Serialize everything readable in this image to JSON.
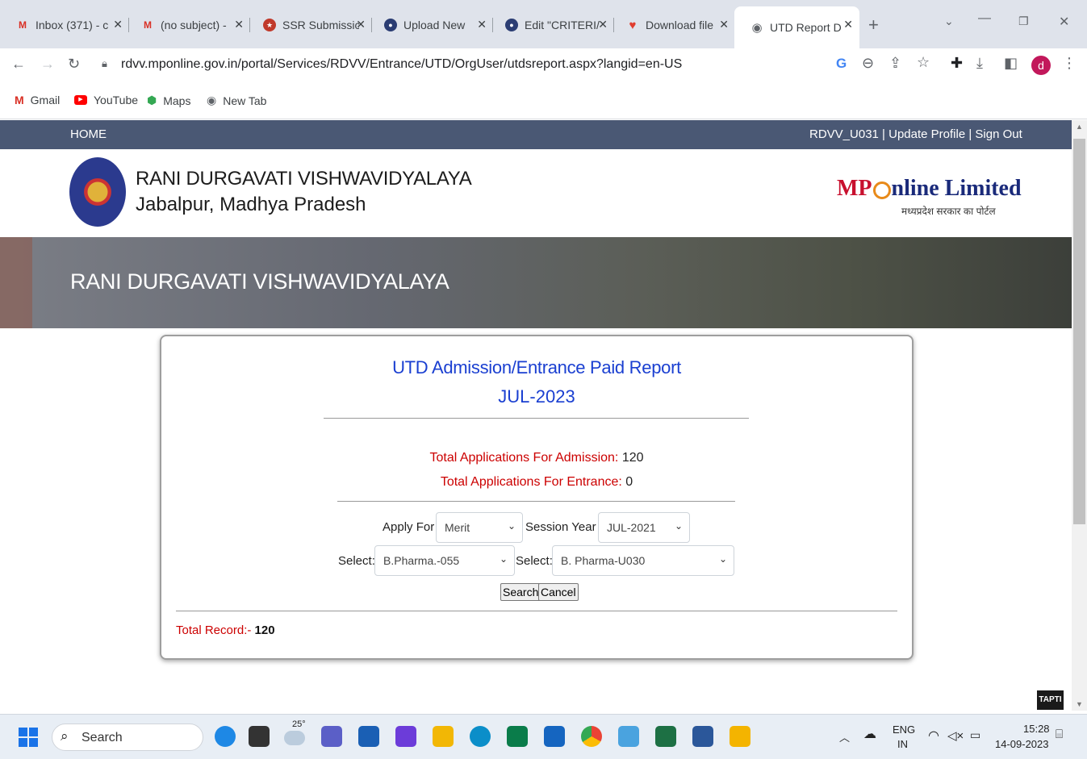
{
  "browser": {
    "tabs": [
      {
        "title": "Inbox (371) - c",
        "icon": "gmail-icon"
      },
      {
        "title": "(no subject) -",
        "icon": "gmail-icon"
      },
      {
        "title": "SSR Submissic",
        "icon": "ssr-icon"
      },
      {
        "title": "Upload New",
        "icon": "upload-icon"
      },
      {
        "title": "Edit \"CRITERI/",
        "icon": "edit-icon"
      },
      {
        "title": "Download file",
        "icon": "heart-icon"
      },
      {
        "title": "UTD Report D",
        "icon": "globe-icon"
      }
    ],
    "url": "rdvv.mponline.gov.in/portal/Services/RDVV/Entrance/UTD/OrgUser/utdsreport.aspx?langid=en-US",
    "profile_initial": "d",
    "bookmarks": [
      {
        "label": "Gmail",
        "icon": "gmail-icon"
      },
      {
        "label": "YouTube",
        "icon": "youtube-icon"
      },
      {
        "label": "Maps",
        "icon": "maps-icon"
      },
      {
        "label": "New Tab",
        "icon": "globe-icon"
      }
    ]
  },
  "nav": {
    "home": "HOME",
    "user": "RDVV_U031",
    "sep1": " | ",
    "update_profile": "Update Profile",
    "sep2": " | ",
    "sign_out": "Sign Out"
  },
  "header": {
    "university_name": "RANI DURGAVATI VISHWAVIDYALAYA",
    "location": "Jabalpur, Madhya Pradesh",
    "brand": "MP",
    "brand_rest": "nline Limited",
    "brand_tagline": "मध्यप्रदेश सरकार का पोर्टल",
    "banner_title": "RANI DURGAVATI VISHWAVIDYALAYA"
  },
  "report": {
    "title": "UTD Admission/Entrance Paid Report",
    "subtitle": "JUL-2023",
    "admission_label": "Total Applications For Admission:",
    "admission_value": "120",
    "entrance_label": "Total Applications For Entrance:",
    "entrance_value": "0",
    "apply_for_label": "Apply For",
    "apply_for_value": "Merit",
    "session_year_label": "Session Year",
    "session_year_value": "JUL-2021",
    "select1_label": "Select:",
    "select1_value": "B.Pharma.-055",
    "select2_label": "Select:",
    "select2_value": "B. Pharma-U030",
    "search_button": "Search",
    "cancel_button": "Cancel",
    "total_record_label": "Total Record:-",
    "total_record_value": "120"
  },
  "tapti_badge": "TAPTI",
  "taskbar": {
    "search_placeholder": "Search",
    "weather_temp": "25°",
    "language": "ENG",
    "region": "IN",
    "time": "15:28",
    "date": "14-09-2023"
  },
  "colors": {
    "nav_bg": "#4a5874",
    "title_blue": "#1a3fd1",
    "count_red": "#cc0000",
    "brand_red": "#c8102e"
  }
}
